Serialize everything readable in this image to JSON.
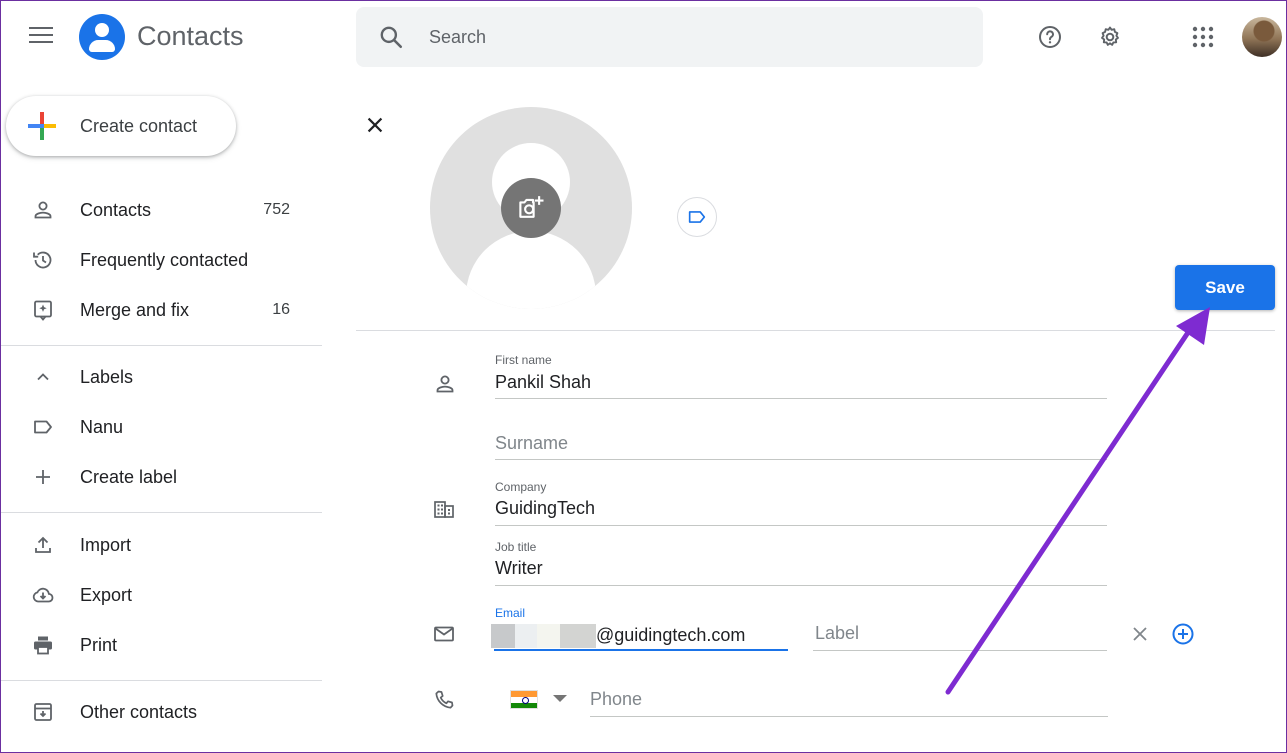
{
  "header": {
    "app_title": "Contacts",
    "search_placeholder": "Search"
  },
  "sidebar": {
    "create_label": "Create contact",
    "items": [
      {
        "label": "Contacts",
        "count": "752",
        "icon": "person-icon"
      },
      {
        "label": "Frequently contacted",
        "count": "",
        "icon": "history-icon"
      },
      {
        "label": "Merge and fix",
        "count": "16",
        "icon": "merge-fix-icon"
      }
    ],
    "labels_header": "Labels",
    "label_items": [
      {
        "label": "Nanu",
        "icon": "label-icon"
      },
      {
        "label": "Create label",
        "icon": "plus-icon"
      }
    ],
    "tools": [
      {
        "label": "Import",
        "icon": "upload-icon"
      },
      {
        "label": "Export",
        "icon": "cloud-download-icon"
      },
      {
        "label": "Print",
        "icon": "printer-icon"
      }
    ],
    "other_contacts": "Other contacts"
  },
  "editor": {
    "save_label": "Save",
    "first_name_label": "First name",
    "first_name_value": "Pankil Shah",
    "surname_placeholder": "Surname",
    "company_label": "Company",
    "company_value": "GuidingTech",
    "job_title_label": "Job title",
    "job_title_value": "Writer",
    "email_label": "Email",
    "email_value": "@guidingtech.com",
    "email_type_placeholder": "Label",
    "phone_placeholder": "Phone",
    "phone_country": "India"
  },
  "colors": {
    "accent": "#1a73e8",
    "annotation_arrow": "#7e2bd1"
  }
}
